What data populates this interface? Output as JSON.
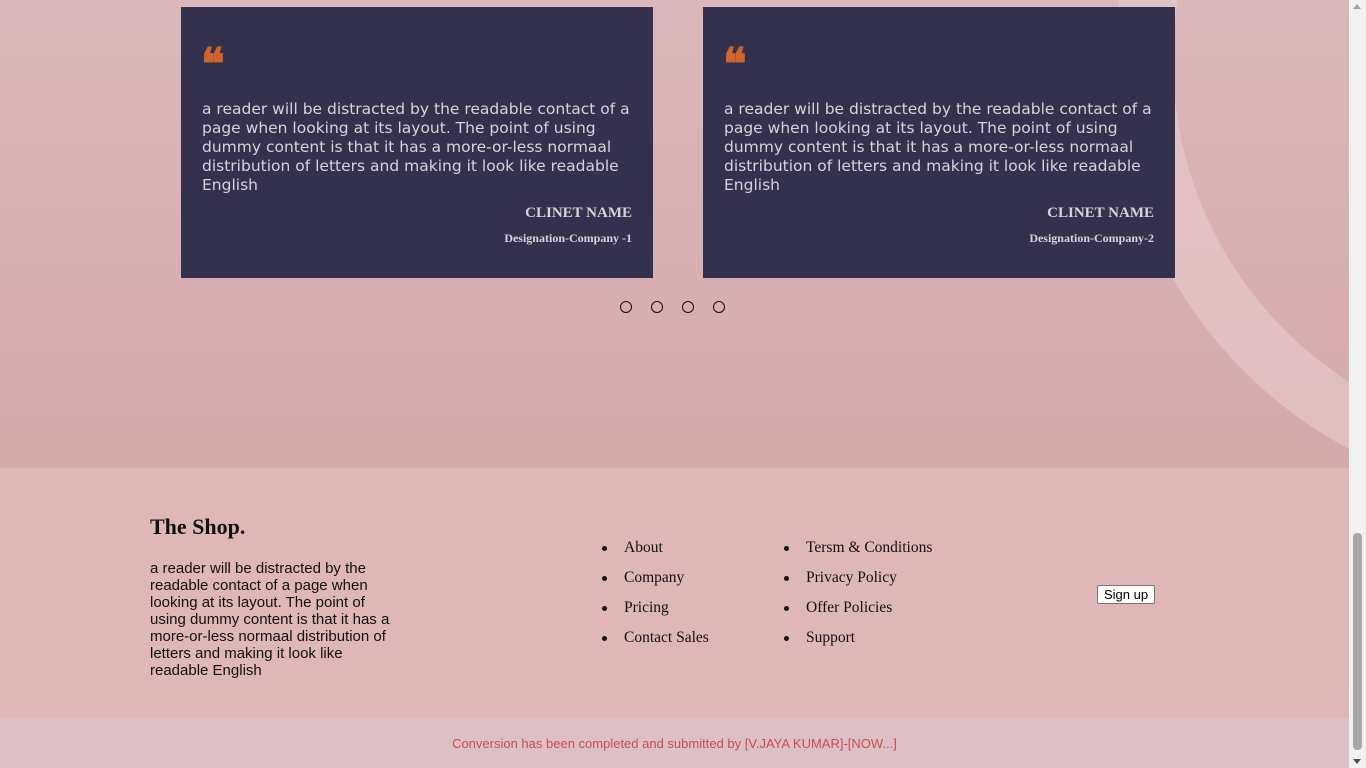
{
  "testimonials": {
    "cards": [
      {
        "quote_glyph": "❝",
        "text": "a reader will be distracted by the readable contact of a page when looking at its layout. The point of using dummy content is that it has a more-or-less normaal distribution of letters and making it look like readable English",
        "client_name": "CLINET NAME",
        "designation": "Designation-Company -1"
      },
      {
        "quote_glyph": "❝",
        "text": "a reader will be distracted by the readable contact of a page when looking at its layout. The point of using dummy content is that it has a more-or-less normaal distribution of letters and making it look like readable English",
        "client_name": "CLINET NAME",
        "designation": "Designation-Company-2"
      }
    ],
    "pager_count": 4,
    "colors": {
      "card_bg": "#33314e",
      "quote_icon": "#d0652a"
    }
  },
  "footer": {
    "brand": "The Shop.",
    "description": "a reader will be distracted by the readable contact of a page when looking at its layout. The point of using dummy content is that it has a more-or-less normaal distribution of letters and making it look like readable English",
    "links_col1": [
      "About",
      "Company",
      "Pricing",
      "Contact Sales"
    ],
    "links_col2": [
      "Tersm & Conditions",
      "Privacy Policy",
      "Offer Policies",
      "Support"
    ],
    "signup_label": "Sign up"
  },
  "bottom_bar": {
    "credit": "Conversion has been completed and submitted by [V.JAYA KUMAR]-[NOW...]"
  }
}
